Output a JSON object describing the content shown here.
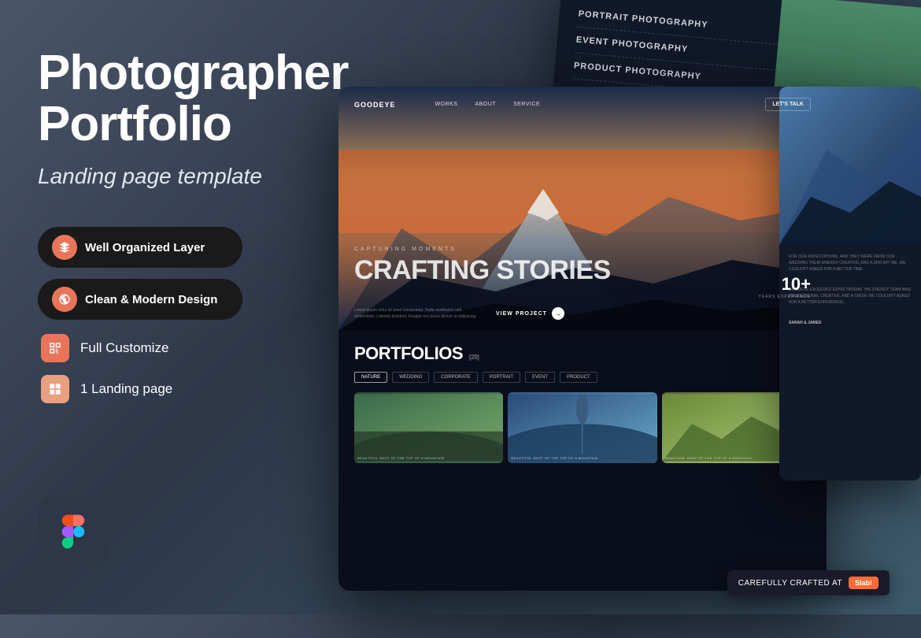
{
  "left": {
    "title": "Photographer Portfolio",
    "subtitle": "Landing page template",
    "features": [
      {
        "id": "layers",
        "label": "Well Organized Layer",
        "type": "badge",
        "icon": "layers-icon",
        "iconColor": "#e8755a"
      },
      {
        "id": "design",
        "label": "Clean & Modern Design",
        "type": "badge",
        "icon": "design-icon",
        "iconColor": "#e8755a"
      },
      {
        "id": "customize",
        "label": "Full Customize",
        "type": "plain",
        "icon": "customize-icon",
        "iconColor": "#e8755a"
      },
      {
        "id": "landing",
        "label": "1 Landing page",
        "type": "plain",
        "icon": "grid-icon",
        "iconColor": "#e8755a"
      }
    ]
  },
  "mock": {
    "nav": {
      "logo": "GOODEYE",
      "links": [
        "WORKS",
        "ABOUT",
        "SERVICE"
      ],
      "cta": "LET'S TALK"
    },
    "hero": {
      "eyebrow": "CAPTURING MOMENTS",
      "title": "CRAFTING STORIES",
      "description": "Lorem ipsum dolor sit amet consectetur. Nulla vestibulum sed consectetur. Lobortis tincidunt. Feugiat orci purus dictum ut adipiscing.",
      "cta": "VIEW PROJECT",
      "stats_num": "10+",
      "stats_label": "YEARS EXPERIENCE"
    },
    "portfolio": {
      "title": "PORTFOLIOS",
      "count": "29",
      "tabs": [
        "NATURE",
        "WEDDING",
        "CORPORATE",
        "PORTRAIT",
        "EVENT",
        "PRODUCT"
      ],
      "active_tab": "NATURE",
      "photos": [
        {
          "label": "BEAUTIFUL SHOT OF THE TOP OF A MOUNTAIN"
        },
        {
          "label": "BEAUTIFUL SHOT OF THE TOP OF A MOUNTAIN"
        },
        {
          "label": "BEAUTIFUL SHOT OF THE TOP OF A MOUNTAIN"
        }
      ]
    },
    "back_nav": {
      "items": [
        {
          "label": "PORTRAIT PHOTOGRAPHY"
        },
        {
          "label": "EVENT PHOTOGRAPHY"
        },
        {
          "label": "PRODUCT PHOTOGRAPHY"
        }
      ]
    }
  },
  "badge": {
    "text": "CAREFULLY CRAFTED AT",
    "brand": "Slab!"
  }
}
